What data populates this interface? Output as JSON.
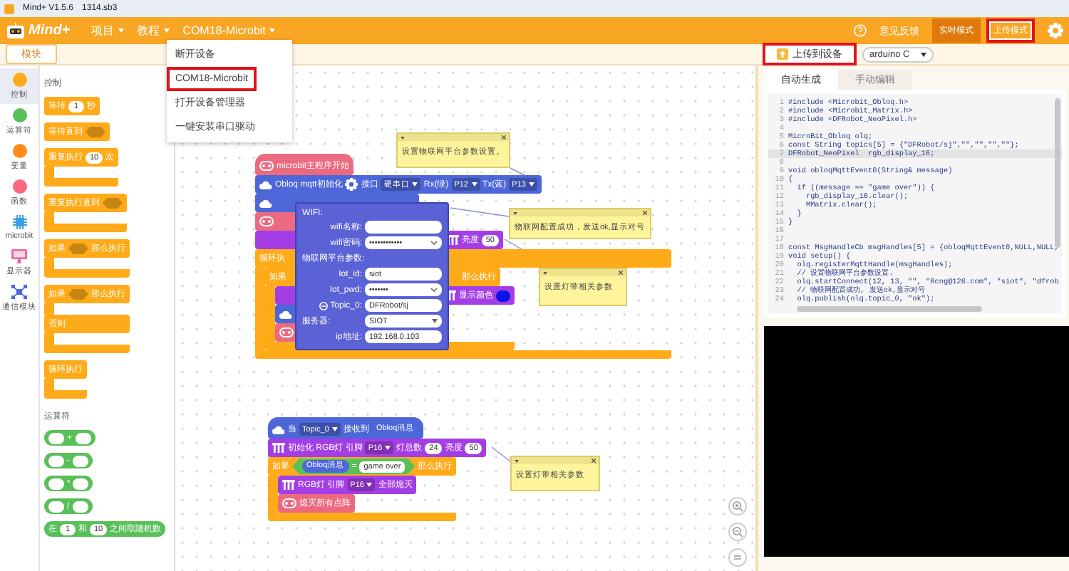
{
  "title_bar": {
    "app": "Mind+ V1.5.6",
    "file": "1314.sb3"
  },
  "menu_bar": {
    "logo": "Mind+",
    "menus": [
      {
        "label": "项目"
      },
      {
        "label": "教程"
      },
      {
        "label": "COM18-Microbit"
      }
    ],
    "feedback": "意见反馈",
    "modes": [
      {
        "label": "实时模式",
        "selected": false,
        "highlighted": false
      },
      {
        "label": "上传模式",
        "selected": true,
        "highlighted": true
      }
    ]
  },
  "device_menu": {
    "items": [
      {
        "label": "断开设备",
        "highlighted": false
      },
      {
        "label": "COM18-Microbit",
        "highlighted": true
      },
      {
        "label": "打开设备管理器",
        "highlighted": false
      },
      {
        "label": "一键安装串口驱动",
        "highlighted": false
      }
    ]
  },
  "left_tab": "模块",
  "upload_button": {
    "label": "上传到设备",
    "highlighted": true
  },
  "language_select": "arduino C",
  "categories": [
    {
      "label": "控制",
      "kind": "dot",
      "color": "#ffab19",
      "selected": true
    },
    {
      "label": "运算符",
      "kind": "dot",
      "color": "#59c059",
      "selected": false
    },
    {
      "label": "变量",
      "kind": "dot",
      "color": "#ff8c1a",
      "selected": false
    },
    {
      "label": "函数",
      "kind": "dot",
      "color": "#ff6680",
      "selected": false
    },
    {
      "label": "microbit",
      "kind": "chip",
      "selected": false
    },
    {
      "label": "显示器",
      "kind": "screen",
      "selected": false
    },
    {
      "label": "通信模块",
      "kind": "network",
      "selected": false
    }
  ],
  "palette": {
    "sections": [
      {
        "title": "控制",
        "blocks": [
          {
            "kind": "stack",
            "color": "#ffab19",
            "parts": [
              {
                "kind": "label",
                "text": "等待"
              },
              {
                "kind": "number",
                "text": "1"
              },
              {
                "kind": "label",
                "text": "秒"
              }
            ]
          },
          {
            "kind": "stack",
            "color": "#ffab19",
            "parts": [
              {
                "kind": "label",
                "text": "等待直到"
              },
              {
                "kind": "boolean_slot"
              }
            ]
          },
          {
            "kind": "c",
            "color": "#ffab19",
            "parts": [
              {
                "kind": "label",
                "text": "重复执行"
              },
              {
                "kind": "number",
                "text": "10"
              },
              {
                "kind": "label",
                "text": "次"
              }
            ]
          },
          {
            "kind": "c",
            "color": "#ffab19",
            "parts": [
              {
                "kind": "label",
                "text": "重复执行直到"
              },
              {
                "kind": "boolean_slot"
              }
            ]
          },
          {
            "kind": "c",
            "color": "#ffab19",
            "parts": [
              {
                "kind": "label",
                "text": "如果"
              },
              {
                "kind": "boolean_slot"
              },
              {
                "kind": "label",
                "text": "那么执行"
              }
            ]
          },
          {
            "kind": "c_else",
            "color": "#ffab19",
            "parts": [
              {
                "kind": "label",
                "text": "如果"
              },
              {
                "kind": "boolean_slot"
              },
              {
                "kind": "label",
                "text": "那么执行"
              }
            ],
            "else_parts": [
              {
                "kind": "label",
                "text": "否则"
              }
            ]
          },
          {
            "kind": "c",
            "color": "#ffab19",
            "parts": [
              {
                "kind": "label",
                "text": "循环执行"
              }
            ]
          }
        ]
      },
      {
        "title": "运算符",
        "blocks": [
          {
            "kind": "reporter",
            "color": "#59c059",
            "parts": [
              {
                "kind": "number"
              },
              {
                "kind": "label",
                "text": "+"
              },
              {
                "kind": "number"
              }
            ]
          },
          {
            "kind": "reporter",
            "color": "#59c059",
            "parts": [
              {
                "kind": "number"
              },
              {
                "kind": "label",
                "text": "-"
              },
              {
                "kind": "number"
              }
            ]
          },
          {
            "kind": "reporter",
            "color": "#59c059",
            "parts": [
              {
                "kind": "number"
              },
              {
                "kind": "label",
                "text": "*"
              },
              {
                "kind": "number"
              }
            ]
          },
          {
            "kind": "reporter",
            "color": "#59c059",
            "parts": [
              {
                "kind": "number"
              },
              {
                "kind": "label",
                "text": "/"
              },
              {
                "kind": "number"
              }
            ]
          },
          {
            "kind": "reporter",
            "color": "#59c059",
            "parts": [
              {
                "kind": "label",
                "text": "在"
              },
              {
                "kind": "number",
                "text": "1"
              },
              {
                "kind": "label",
                "text": "和"
              },
              {
                "kind": "number",
                "text": "10"
              },
              {
                "kind": "label",
                "text": "之间取随机数"
              }
            ]
          }
        ]
      }
    ]
  },
  "canvas": {
    "stacks": [
      {
        "blocks": [
          {
            "kind": "hat",
            "color": "#ec6a7f",
            "parts": [
              {
                "kind": "matrix_icon"
              },
              {
                "kind": "label",
                "text": "microbit主程序开始"
              }
            ]
          },
          {
            "kind": "stack",
            "color": "#4d66d8",
            "parts": [
              {
                "kind": "cloud_icon"
              },
              {
                "kind": "label",
                "text": "Obloq mqtt初始化"
              },
              {
                "kind": "gear"
              },
              {
                "kind": "label",
                "text": "接口"
              },
              {
                "kind": "dropdown",
                "text": "硬串口"
              },
              {
                "kind": "label",
                "text": "Rx(绿)"
              },
              {
                "kind": "dropdown",
                "text": "P12"
              },
              {
                "kind": "label",
                "text": "Tx(蓝)"
              },
              {
                "kind": "dropdown",
                "text": "P13"
              }
            ]
          },
          {
            "kind": "stack",
            "color": "#4d66d8",
            "parts": [
              {
                "kind": "cloud_icon"
              }
            ]
          },
          {
            "kind": "stack",
            "color": "#ec6a7f",
            "parts": [
              {
                "kind": "matrix_icon"
              }
            ]
          },
          {
            "kind": "stack",
            "color": "#a33ee6",
            "parts": [
              {
                "kind": "led_icon"
              },
              {
                "kind": "label",
                "text": "亮度"
              },
              {
                "kind": "number",
                "text": "50"
              }
            ]
          },
          {
            "kind": "c",
            "color": "#ffab19",
            "parts": [
              {
                "kind": "label",
                "text": "循环执"
              }
            ],
            "children": [
              {
                "kind": "c",
                "color": "#ffab19",
                "parts": [
                  {
                    "kind": "label",
                    "text": "如果"
                  },
                  {
                    "kind": "label",
                    "text": "那么执行"
                  }
                ],
                "children": [
                  {
                    "kind": "stack",
                    "color": "#a33ee6",
                    "parts": [
                      {
                        "kind": "led_icon"
                      },
                      {
                        "kind": "label",
                        "text": "显示颜色"
                      },
                      {
                        "kind": "swatch",
                        "color": "#0a14e6"
                      }
                    ]
                  },
                  {
                    "kind": "stack",
                    "color": "#4d66d8",
                    "parts": [
                      {
                        "kind": "cloud_icon"
                      }
                    ]
                  },
                  {
                    "kind": "stack",
                    "color": "#ec6a7f",
                    "parts": [
                      {
                        "kind": "matrix_icon"
                      }
                    ]
                  }
                ]
              }
            ]
          }
        ]
      },
      {
        "blocks": [
          {
            "kind": "hat",
            "color": "#4d66d8",
            "parts": [
              {
                "kind": "cloud_icon"
              },
              {
                "kind": "label",
                "text": "当"
              },
              {
                "kind": "dropdown",
                "text": "Topic_0"
              },
              {
                "kind": "label",
                "text": "接收到"
              },
              {
                "kind": "reporter",
                "color": "#4d66d8",
                "text": "Obloq消息"
              }
            ]
          },
          {
            "kind": "stack",
            "color": "#a33ee6",
            "parts": [
              {
                "kind": "led_icon"
              },
              {
                "kind": "label",
                "text": "初始化 RGB灯 引脚"
              },
              {
                "kind": "dropdown",
                "text": "P16"
              },
              {
                "kind": "label",
                "text": "灯总数"
              },
              {
                "kind": "number",
                "text": "24"
              },
              {
                "kind": "label",
                "text": "亮度"
              },
              {
                "kind": "number",
                "text": "50"
              }
            ]
          },
          {
            "kind": "c",
            "color": "#ffab19",
            "parts": [
              {
                "kind": "label",
                "text": "如果"
              },
              {
                "kind": "condition",
                "color": "#59c059",
                "parts": [
                  {
                    "kind": "reporter",
                    "color": "#4d66d8",
                    "text": "Obloq消息"
                  },
                  {
                    "kind": "label",
                    "text": "="
                  },
                  {
                    "kind": "text",
                    "text": "game over"
                  }
                ]
              },
              {
                "kind": "label",
                "text": "那么执行"
              }
            ],
            "children": [
              {
                "kind": "stack",
                "color": "#a33ee6",
                "parts": [
                  {
                    "kind": "led_icon"
                  },
                  {
                    "kind": "label",
                    "text": "RGB灯 引脚"
                  },
                  {
                    "kind": "dropdown",
                    "text": "P16"
                  },
                  {
                    "kind": "label",
                    "text": "全部熄灭"
                  }
                ]
              },
              {
                "kind": "stack",
                "color": "#ec6a7f",
                "parts": [
                  {
                    "kind": "matrix_icon"
                  },
                  {
                    "kind": "label",
                    "text": "熄灭所有点阵"
                  }
                ]
              }
            ]
          }
        ]
      }
    ],
    "notes": [
      {
        "text": "设置物联网平台参数设置。"
      },
      {
        "text": "物联网配置成功，发送ok,显示对号"
      },
      {
        "text": "设置灯带相关参数"
      },
      {
        "text": "设置灯带相关参数"
      }
    ]
  },
  "mqtt_popup": {
    "rows": [
      {
        "kind": "heading",
        "text": "WIFI:"
      },
      {
        "kind": "field",
        "label": "wifi名称:"
      },
      {
        "kind": "password",
        "label": "wifi密码:",
        "value": "••••••••••••"
      },
      {
        "kind": "heading",
        "text": "物联网平台参数:"
      },
      {
        "kind": "field",
        "label": "Iot_id:",
        "value": "siot"
      },
      {
        "kind": "password",
        "label": "Iot_pwd:",
        "value": "•••••••"
      },
      {
        "kind": "topic",
        "label": "Topic_0:",
        "value": "DFRobot/sj"
      },
      {
        "kind": "select",
        "label": "服务器:",
        "value": "SIOT"
      },
      {
        "kind": "field",
        "label": "ip地址:",
        "value": "192.168.0.103"
      }
    ]
  },
  "code_panel": {
    "tabs": [
      {
        "label": "自动生成",
        "selected": true
      },
      {
        "label": "手动编辑",
        "selected": false
      }
    ],
    "lines": [
      {
        "number": "1",
        "text": "#include <Microbit_Obloq.h>",
        "current": false
      },
      {
        "number": "2",
        "text": "#include <Microbit_Matrix.h>",
        "current": false
      },
      {
        "number": "3",
        "text": "#include <DFRobot_NeoPixel.h>",
        "current": false
      },
      {
        "number": "4",
        "current": false
      },
      {
        "number": "5",
        "text": "MicroBit_Obloq olq;",
        "current": false
      },
      {
        "number": "6",
        "text": "const String topics[5] = {\"DFRobot/sj\",\"\",\"\",\"\",\"\"};",
        "current": false
      },
      {
        "number": "7",
        "text": "DFRobot_NeoPixel  rgb_display_16;",
        "current": true
      },
      {
        "number": "8",
        "current": false
      },
      {
        "number": "9",
        "text": "void obloqMqttEvent0(String& message)",
        "current": false
      },
      {
        "number": "10",
        "text": "{",
        "current": false
      },
      {
        "number": "11",
        "text": "  if ((message == \"game over\")) {",
        "current": false
      },
      {
        "number": "12",
        "text": "    rgb_display_16.clear();",
        "current": false
      },
      {
        "number": "13",
        "text": "    MMatrix.clear();",
        "current": false
      },
      {
        "number": "14",
        "text": "  }",
        "current": false
      },
      {
        "number": "15",
        "text": "}",
        "current": false
      },
      {
        "number": "16",
        "current": false
      },
      {
        "number": "17",
        "current": false
      },
      {
        "number": "18",
        "text": "const MsgHandleCb msgHandles[5] = {obloqMqttEvent0,NULL,NULL,",
        "current": false
      },
      {
        "number": "19",
        "text": "void setup() {",
        "current": false
      },
      {
        "number": "20",
        "text": "  olq.registerMqttHandle(msgHandles);",
        "current": false
      },
      {
        "number": "21",
        "text": "  // 设置物联网平台参数设置.",
        "current": false
      },
      {
        "number": "22",
        "text": "  olq.startConnect(12, 13, \"\", \"Rcog@126.com\", \"siot\", \"dfrob",
        "current": false
      },
      {
        "number": "23",
        "text": "  // 物联网配置成功, 发送ok,显示对号",
        "current": false
      },
      {
        "number": "24",
        "text": "  olq.publish(olq.topic_0, \"ok\");",
        "current": false
      }
    ]
  }
}
